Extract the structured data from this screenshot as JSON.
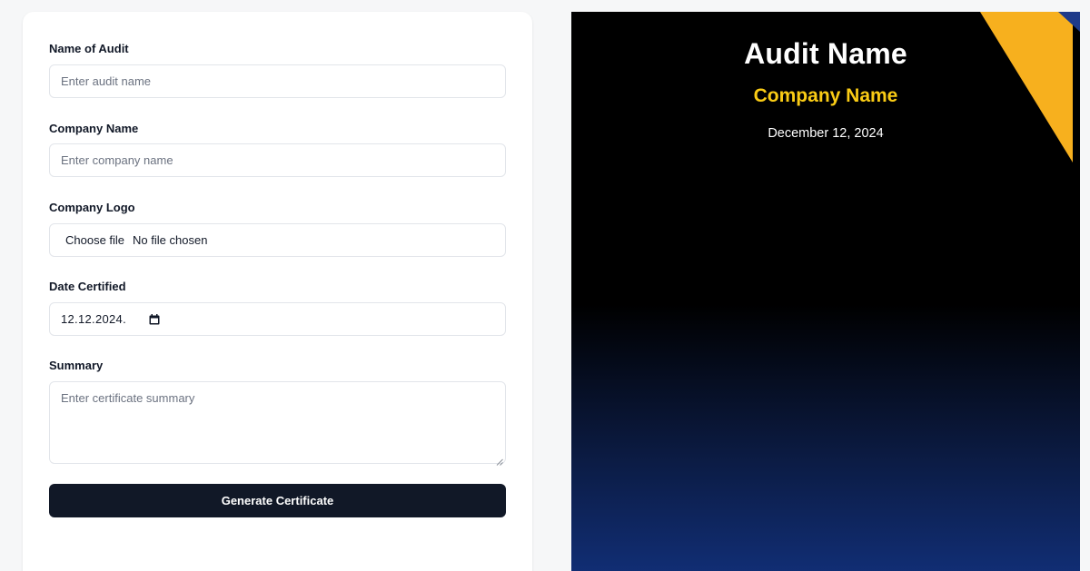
{
  "form": {
    "audit_name": {
      "label": "Name of Audit",
      "placeholder": "Enter audit name",
      "value": ""
    },
    "company_name": {
      "label": "Company Name",
      "placeholder": "Enter company name",
      "value": ""
    },
    "company_logo": {
      "label": "Company Logo",
      "button_label": "Choose file",
      "status": "No file chosen"
    },
    "date_certified": {
      "label": "Date Certified",
      "value": "12.12.2024.",
      "icon": "calendar-icon"
    },
    "summary": {
      "label": "Summary",
      "placeholder": "Enter certificate summary",
      "value": ""
    },
    "submit_label": "Generate Certificate"
  },
  "certificate": {
    "title": "Audit Name",
    "company": "Company Name",
    "date": "December 12, 2024",
    "colors": {
      "background_top": "#000000",
      "background_bottom": "#112e75",
      "accent": "#facc15",
      "stripe_yellow": "#f7b01e",
      "stripe_blue": "#1e3a8a"
    }
  }
}
